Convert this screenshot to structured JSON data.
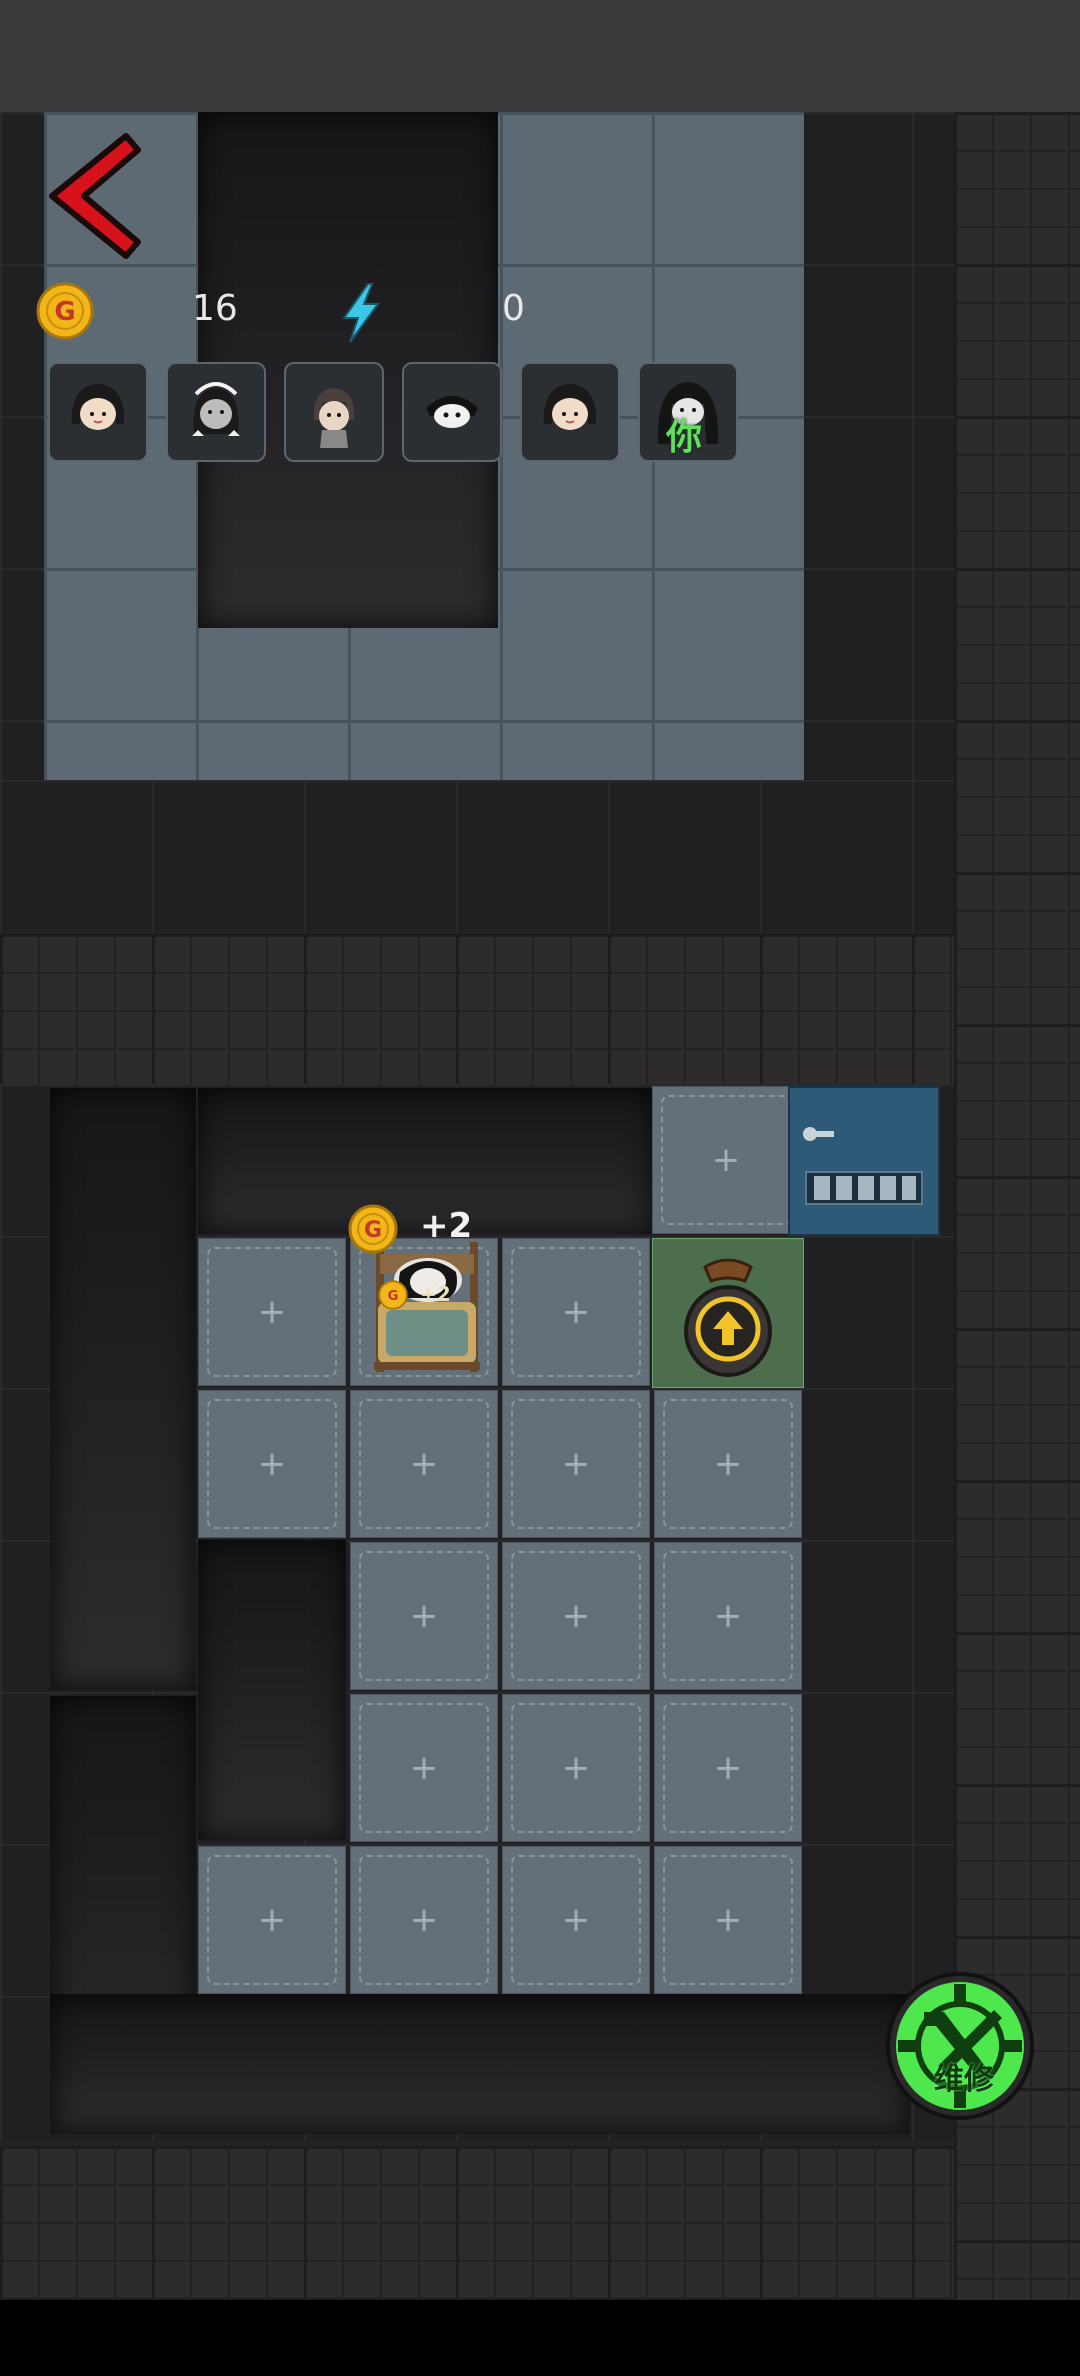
{
  "hud": {
    "back_icon": "back-arrow-icon",
    "coins": "16",
    "energy": "0",
    "coin_icon": "gold-coin-icon",
    "coin_letter": "G",
    "energy_icon": "lightning-bolt-icon"
  },
  "roster": {
    "avatars": [
      "girl-avatar",
      "bow-girl-avatar",
      "ponytail-girl-avatar",
      "ghost-avatar",
      "girl-avatar",
      "ghost-girl-you-avatar"
    ],
    "you_label": "你"
  },
  "room": {
    "coin_gain_big": "+2",
    "coin_gain_small": "+2"
  },
  "actions": {
    "repair_label": "维修",
    "repair_icon": "wrench-gear-icon",
    "upgrade_icon": "upgrade-bag-icon"
  },
  "colors": {
    "accent_red": "#d8121a",
    "repair_green": "#4ee84e",
    "coin_gold": "#f2b619",
    "energy_blue": "#3ec6e6",
    "door_blue": "#2e5a78"
  }
}
